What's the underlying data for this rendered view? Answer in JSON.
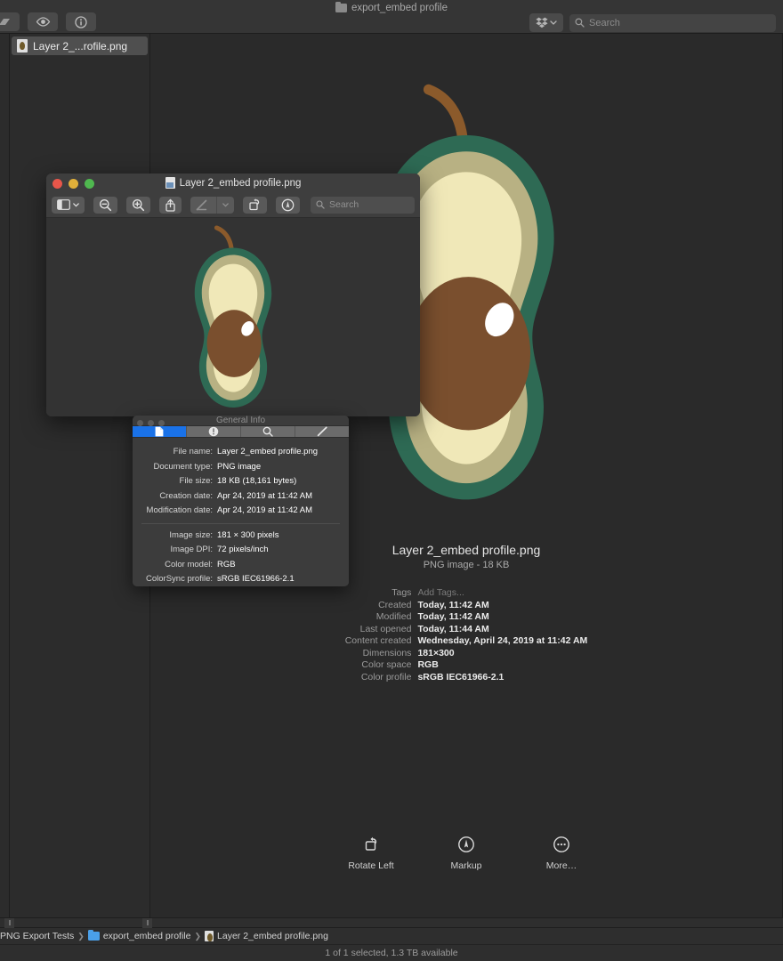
{
  "finder": {
    "title": "export_embed profile",
    "toolbar_buttons": [
      {
        "name": "action-button",
        "icon": "action-icon"
      },
      {
        "name": "quick-look-button",
        "icon": "eye-icon"
      },
      {
        "name": "get-info-button",
        "icon": "info-icon"
      }
    ],
    "dropbox_label": "",
    "search": {
      "placeholder": "Search",
      "value": ""
    },
    "files": [
      {
        "label": "Layer 2_...rofile.png",
        "selected": true
      }
    ],
    "preview": {
      "filename": "Layer 2_embed profile.png",
      "kind": "PNG image - 18 KB",
      "metadata": [
        {
          "key": "Tags",
          "value": "Add Tags...",
          "muted": true
        },
        {
          "key": "Created",
          "value": "Today, 11:42 AM",
          "muted": false
        },
        {
          "key": "Modified",
          "value": "Today, 11:42 AM",
          "muted": false
        },
        {
          "key": "Last opened",
          "value": "Today, 11:44 AM",
          "muted": false
        },
        {
          "key": "Content created",
          "value": "Wednesday, April 24, 2019 at 11:42 AM",
          "muted": false
        },
        {
          "key": "Dimensions",
          "value": "181×300",
          "muted": false
        },
        {
          "key": "Color space",
          "value": "RGB",
          "muted": false
        },
        {
          "key": "Color profile",
          "value": "sRGB IEC61966-2.1",
          "muted": false
        }
      ],
      "actions": [
        {
          "label": "Rotate Left",
          "icon": "rotate-left-icon"
        },
        {
          "label": "Markup",
          "icon": "markup-icon"
        },
        {
          "label": "More…",
          "icon": "more-icon"
        }
      ]
    },
    "path_bar": [
      {
        "label": "PNG Export Tests",
        "icon": "none"
      },
      {
        "label": "export_embed profile",
        "icon": "folder-icon"
      },
      {
        "label": "Layer 2_embed profile.png",
        "icon": "file-icon"
      }
    ],
    "path_separator": "❯",
    "status": "1 of 1 selected, 1.3 TB available"
  },
  "preview_window": {
    "title": "Layer 2_embed profile.png",
    "traffic_lights": [
      "close-button",
      "minimize-button",
      "zoom-button"
    ],
    "toolbar_buttons": [
      {
        "name": "sidebar-toggle-button",
        "icon": "sidebar-icon"
      },
      {
        "name": "zoom-out-button",
        "icon": "magnifier-minus-icon"
      },
      {
        "name": "zoom-in-button",
        "icon": "magnifier-plus-icon"
      },
      {
        "name": "share-button",
        "icon": "share-icon"
      },
      {
        "name": "markup-toolbar-button",
        "icon": "pen-icon"
      },
      {
        "name": "rotate-button",
        "icon": "rotate-icon"
      },
      {
        "name": "annotate-button",
        "icon": "annotate-icon"
      }
    ],
    "search": {
      "placeholder": "Search",
      "value": ""
    }
  },
  "info_panel": {
    "title": "General Info",
    "tabs": [
      {
        "name": "general-tab",
        "icon": "document-icon",
        "active": true
      },
      {
        "name": "more-info-tab",
        "icon": "info-circle-icon",
        "active": false
      },
      {
        "name": "keywords-tab",
        "icon": "magnifier-icon",
        "active": false
      },
      {
        "name": "annotations-tab",
        "icon": "pencil-icon",
        "active": false
      }
    ],
    "rows_top": [
      {
        "key": "File name:",
        "value": "Layer 2_embed profile.png"
      },
      {
        "key": "Document type:",
        "value": "PNG image"
      },
      {
        "key": "File size:",
        "value": "18 KB (18,161 bytes)"
      },
      {
        "key": "Creation date:",
        "value": "Apr 24, 2019 at 11:42 AM"
      },
      {
        "key": "Modification date:",
        "value": "Apr 24, 2019 at 11:42 AM"
      }
    ],
    "rows_bottom": [
      {
        "key": "Image size:",
        "value": "181 × 300 pixels"
      },
      {
        "key": "Image DPI:",
        "value": "72 pixels/inch"
      },
      {
        "key": "Color model:",
        "value": "RGB"
      },
      {
        "key": "ColorSync profile:",
        "value": "sRGB IEC61966-2.1"
      }
    ]
  },
  "artwork": {
    "name": "avocado-half-illustration",
    "colors": {
      "rim": "#2e6a54",
      "flesh": "#b8b183",
      "inner": "#f0e8b8",
      "pit": "#7a4f2e",
      "highlight": "#ffffff",
      "stem": "#8b5a2b"
    }
  }
}
